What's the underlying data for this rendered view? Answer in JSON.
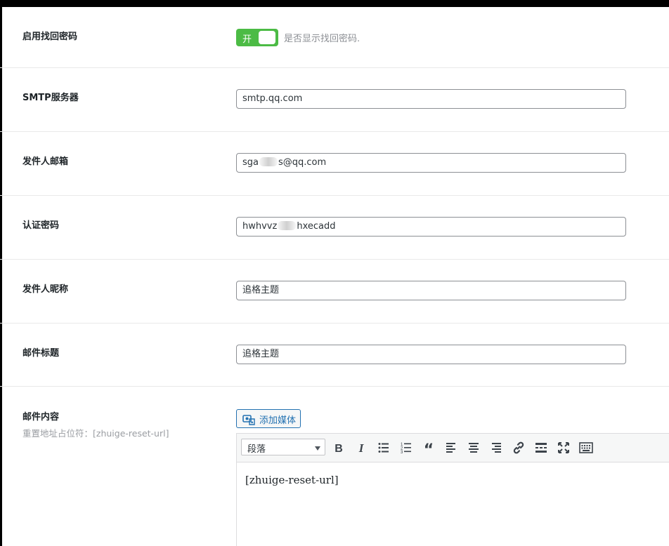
{
  "rows": {
    "reset_enable": {
      "label": "启用找回密码",
      "toggle_label": "开",
      "toggle_on": true,
      "description": "是否显示找回密码."
    },
    "smtp_server": {
      "label": "SMTP服务器",
      "value": "smtp.qq.com"
    },
    "sender_email": {
      "label": "发件人邮箱",
      "value_prefix": "sga",
      "value_suffix": "s@qq.com"
    },
    "auth_password": {
      "label": "认证密码",
      "value_prefix": "hwhvvz",
      "value_suffix": "hxecadd"
    },
    "sender_name": {
      "label": "发件人昵称",
      "value": "追格主题"
    },
    "mail_subject": {
      "label": "邮件标题",
      "value": "追格主题"
    },
    "mail_content": {
      "label": "邮件内容",
      "hint": "重置地址占位符：[zhuige-reset-url]",
      "add_media_label": "添加媒体",
      "format_select": "段落",
      "editor_text": "[zhuige-reset-url]"
    }
  },
  "toolbar_icons": [
    "bold-icon",
    "italic-icon",
    "bullet-list-icon",
    "numbered-list-icon",
    "blockquote-icon",
    "align-left-icon",
    "align-center-icon",
    "align-right-icon",
    "link-icon",
    "read-more-icon",
    "fullscreen-icon",
    "toolbar-toggle-icon"
  ],
  "colors": {
    "toggle_on": "#4cbb45",
    "link_blue": "#2271b1",
    "border": "#8c8f94"
  }
}
